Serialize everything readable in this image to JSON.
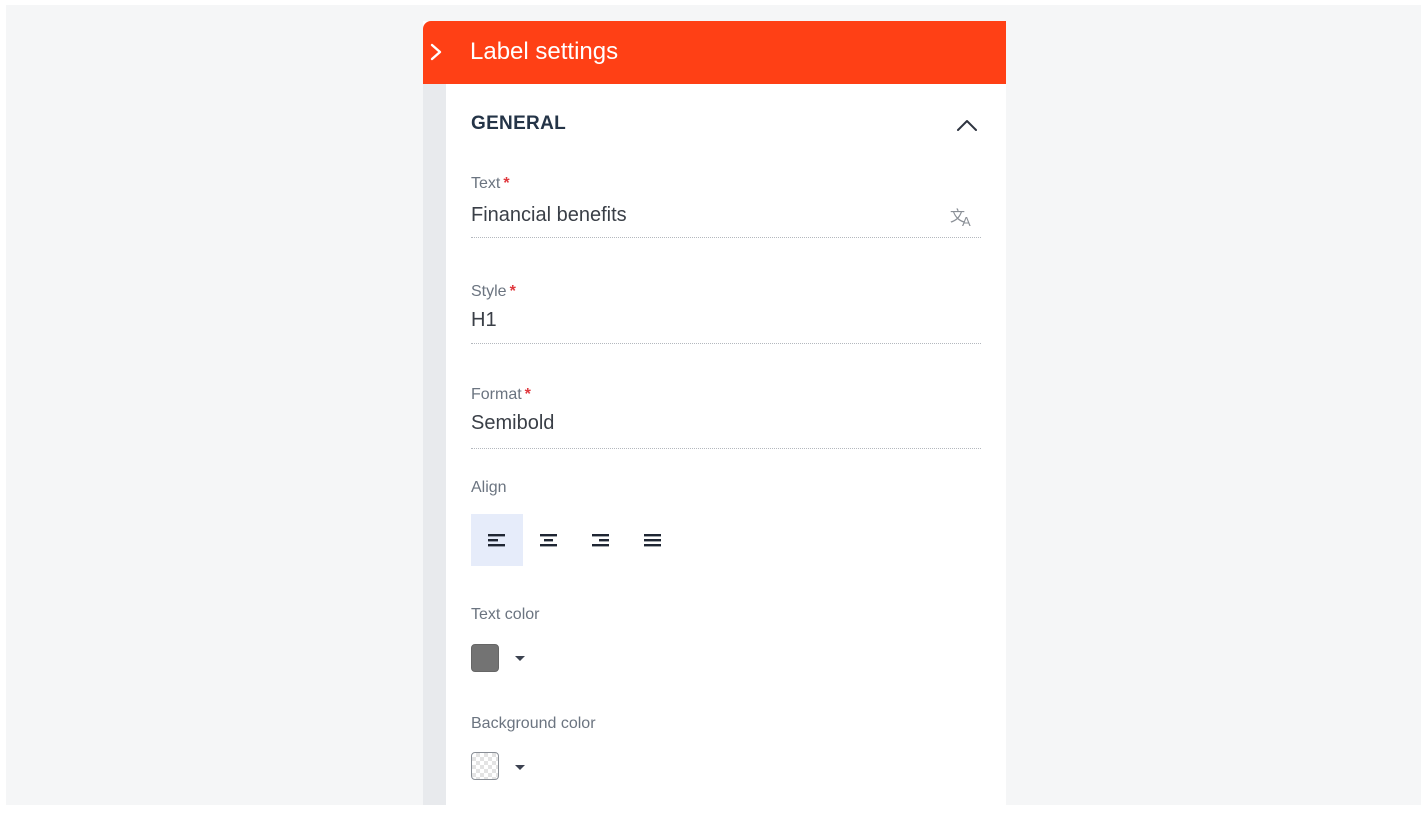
{
  "panel": {
    "title": "Label settings",
    "header_color": "#ff4015",
    "icons": {
      "expand": "chevron-right-icon"
    }
  },
  "general": {
    "section_title": "GENERAL",
    "collapse_icon": "chevron-up-icon",
    "text": {
      "label": "Text",
      "required_mark": "*",
      "value": "Financial benefits",
      "icon": "translate-icon"
    },
    "style": {
      "label": "Style",
      "required_mark": "*",
      "value": "H1"
    },
    "format": {
      "label": "Format",
      "required_mark": "*",
      "value": "Semibold"
    },
    "align": {
      "label": "Align",
      "options": [
        "align-left-icon",
        "align-center-icon",
        "align-right-icon",
        "align-justify-icon"
      ],
      "selected": "align-left-icon"
    },
    "text_color": {
      "label": "Text color",
      "value": "#737373",
      "icon": "caret-down-icon"
    },
    "background_color": {
      "label": "Background color",
      "value": "transparent",
      "icon": "caret-down-icon"
    }
  }
}
